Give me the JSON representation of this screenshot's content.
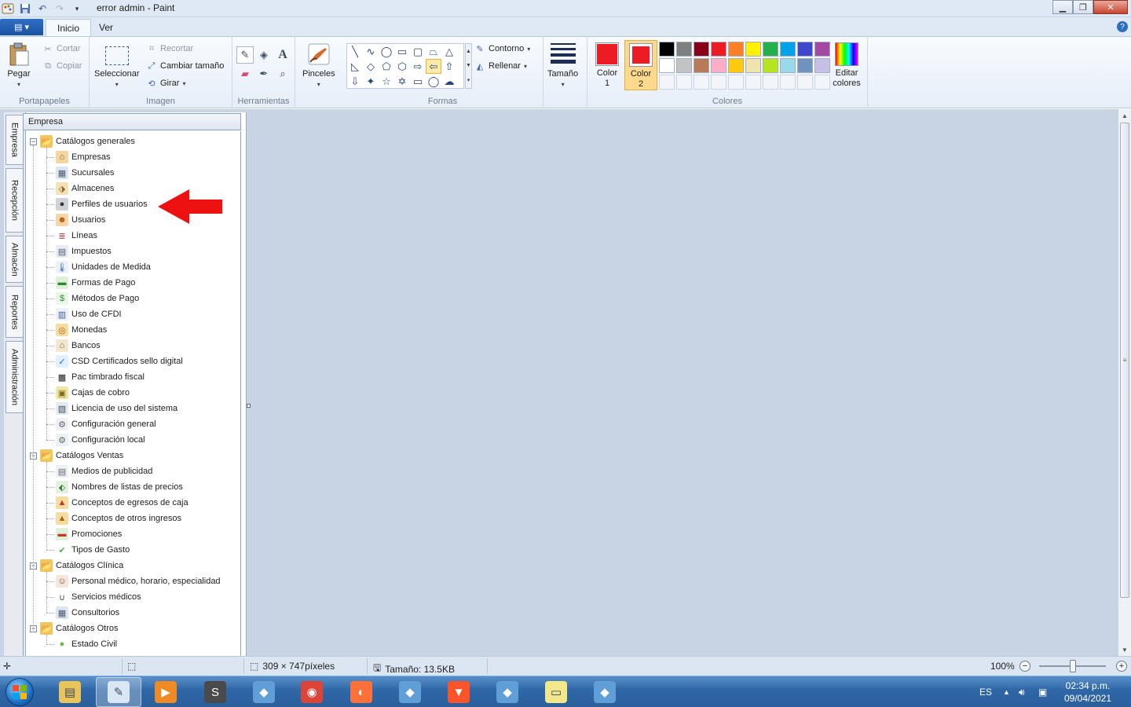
{
  "window": {
    "title": "error admin - Paint"
  },
  "tabs": {
    "file_label": "▤ ▾",
    "inicio": "Inicio",
    "ver": "Ver"
  },
  "ribbon": {
    "portapapeles": {
      "label": "Portapapeles",
      "pegar": "Pegar",
      "cortar": "Cortar",
      "copiar": "Copiar"
    },
    "imagen": {
      "label": "Imagen",
      "seleccionar": "Seleccionar",
      "recortar": "Recortar",
      "cambiar_tamano": "Cambiar tamaño",
      "girar": "Girar"
    },
    "herramientas": {
      "label": "Herramientas"
    },
    "pinceles": {
      "label": "Pinceles"
    },
    "formas": {
      "label": "Formas",
      "contorno": "Contorno",
      "rellenar": "Rellenar"
    },
    "tamano": {
      "label": "Tamaño"
    },
    "colores": {
      "label": "Colores",
      "color1_l1": "Color",
      "color1_l2": "1",
      "color2_l1": "Color",
      "color2_l2": "2",
      "editar_l1": "Editar",
      "editar_l2": "colores",
      "color1": "#ed1c24",
      "color2": "#ed1c24",
      "palette_row1": [
        "#000000",
        "#7f7f7f",
        "#880015",
        "#ed1c24",
        "#ff7f27",
        "#fff200",
        "#22b14c",
        "#00a2e8",
        "#3f48cc",
        "#a349a4"
      ],
      "palette_row2": [
        "#ffffff",
        "#c3c3c3",
        "#b97a57",
        "#ffaec9",
        "#ffc90e",
        "#efe4b0",
        "#b5e61d",
        "#99d9ea",
        "#7092be",
        "#c8bfe7"
      ]
    }
  },
  "app": {
    "side_tabs": [
      "Empresa",
      "Recepción",
      "Almacén",
      "Reportes",
      "Administración"
    ],
    "panel_title": "Empresa",
    "tree": [
      {
        "label": "Catálogos generales",
        "level": 0,
        "icon": "folder-open-icon"
      },
      {
        "label": "Empresas",
        "level": 1,
        "icon": "house-icon"
      },
      {
        "label": "Sucursales",
        "level": 1,
        "icon": "building-icon"
      },
      {
        "label": "Almacenes",
        "level": 1,
        "icon": "warehouse-icon"
      },
      {
        "label": "Perfiles de usuarios",
        "level": 1,
        "icon": "user-profile-icon"
      },
      {
        "label": "Usuarios",
        "level": 1,
        "icon": "users-icon"
      },
      {
        "label": "Líneas",
        "level": 1,
        "icon": "list-icon"
      },
      {
        "label": "Impuestos",
        "level": 1,
        "icon": "tax-icon"
      },
      {
        "label": "Unidades de Medida",
        "level": 1,
        "icon": "thermometer-icon"
      },
      {
        "label": "Formas de Pago",
        "level": 1,
        "icon": "money-icon"
      },
      {
        "label": "Métodos de Pago",
        "level": 1,
        "icon": "dollar-icon"
      },
      {
        "label": "Uso de CFDI",
        "level": 1,
        "icon": "document-icon"
      },
      {
        "label": "Monedas",
        "level": 1,
        "icon": "coins-icon"
      },
      {
        "label": "Bancos",
        "level": 1,
        "icon": "bank-icon"
      },
      {
        "label": "CSD Certificados sello digital",
        "level": 1,
        "icon": "check-icon"
      },
      {
        "label": "Pac timbrado fiscal",
        "level": 1,
        "icon": "qr-icon"
      },
      {
        "label": "Cajas de cobro",
        "level": 1,
        "icon": "cash-register-icon"
      },
      {
        "label": "Licencia de uso del sistema",
        "level": 1,
        "icon": "license-icon"
      },
      {
        "label": "Configuración general",
        "level": 1,
        "icon": "gear-icon"
      },
      {
        "label": "Configuración local",
        "level": 1,
        "icon": "gear-icon"
      },
      {
        "label": "Catálogos Ventas",
        "level": 0,
        "icon": "folder-open-icon"
      },
      {
        "label": "Medios de publicidad",
        "level": 1,
        "icon": "newspaper-icon"
      },
      {
        "label": "Nombres de listas de precios",
        "level": 1,
        "icon": "price-tag-icon"
      },
      {
        "label": "Conceptos de egresos de caja",
        "level": 1,
        "icon": "cash-out-icon"
      },
      {
        "label": "Conceptos de otros ingresos",
        "level": 1,
        "icon": "cash-in-icon"
      },
      {
        "label": "Promociones",
        "level": 1,
        "icon": "promo-icon"
      },
      {
        "label": "Tipos de Gasto",
        "level": 1,
        "icon": "checkmark-icon"
      },
      {
        "label": "Catálogos Clínica",
        "level": 0,
        "icon": "folder-open-icon"
      },
      {
        "label": "Personal médico, horario, especialidad",
        "level": 1,
        "icon": "doctor-icon"
      },
      {
        "label": "Servicios médicos",
        "level": 1,
        "icon": "stethoscope-icon"
      },
      {
        "label": "Consultorios",
        "level": 1,
        "icon": "building-icon"
      },
      {
        "label": "Catálogos Otros",
        "level": 0,
        "icon": "folder-open-icon"
      },
      {
        "label": "Estado Civil",
        "level": 1,
        "icon": "dot-icon"
      }
    ]
  },
  "status": {
    "dimensions": "309 × 747píxeles",
    "size": "Tamaño: 13.5KB",
    "zoom": "100%",
    "zoom_fraction": 0.5
  },
  "taskbar": {
    "apps": [
      "explorer-icon",
      "paint-icon",
      "media-player-icon",
      "sublime-icon",
      "app-icon",
      "chrome-icon",
      "firefox-icon",
      "app-icon",
      "brave-icon",
      "app-icon",
      "notes-icon",
      "app-icon"
    ],
    "lang": "ES",
    "time": "02:34 p.m.",
    "date": "09/04/2021"
  }
}
